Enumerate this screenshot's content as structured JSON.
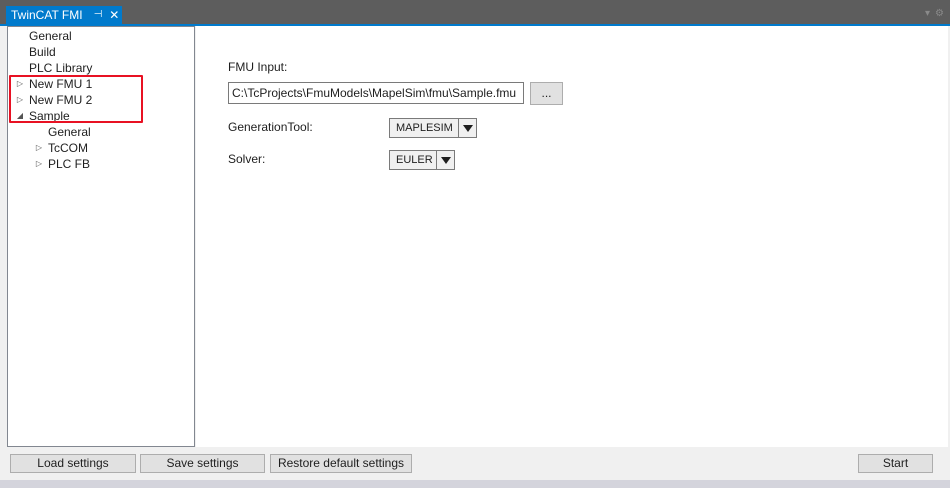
{
  "window": {
    "tab_title": "TwinCAT FMI",
    "pin_glyph": "⊣",
    "close_glyph": "✕"
  },
  "tree": {
    "items": [
      {
        "label": "General"
      },
      {
        "label": "Build"
      },
      {
        "label": "PLC Library"
      },
      {
        "label": "New FMU 1",
        "expander": "▷"
      },
      {
        "label": "New FMU 2",
        "expander": "▷"
      },
      {
        "label": "Sample",
        "expander": "◢"
      },
      {
        "label": "General"
      },
      {
        "label": "TcCOM",
        "expander": "▷"
      },
      {
        "label": "PLC FB",
        "expander": "▷"
      }
    ]
  },
  "form": {
    "fmu_input_label": "FMU Input:",
    "fmu_input_value": "C:\\TcProjects\\FmuModels\\MapelSim\\fmu\\Sample.fmu",
    "browse_label": "...",
    "generation_tool_label": "GenerationTool:",
    "generation_tool_value": "MAPLESIM",
    "solver_label": "Solver:",
    "solver_value": "EULER"
  },
  "buttons": {
    "load": "Load settings",
    "save": "Save settings",
    "restore": "Restore default settings",
    "start": "Start"
  },
  "colors": {
    "accent": "#007acc",
    "highlight": "#e81123"
  }
}
